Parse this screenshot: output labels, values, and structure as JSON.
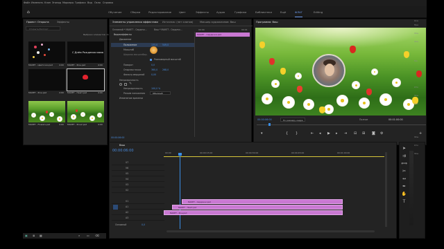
{
  "menu": {
    "items": [
      "Файл",
      "Изменить",
      "Клип",
      "Эпизод",
      "Маркеры",
      "Графика",
      "Вид",
      "Окно",
      "Справка"
    ]
  },
  "workspaces": {
    "items": [
      "Обучение",
      "Сборка",
      "Редактирование",
      "Цвет",
      "Эффекты",
      "Аудио",
      "Графика",
      "Библиотеки",
      "Ещё",
      "ФЛАГ",
      "Editing"
    ],
    "active": "ФЛАГ"
  },
  "project": {
    "tab_active": "Проект: Открыта",
    "tab_other": "Эффекты",
    "search_placeholder": "Открыть/Экспорт",
    "items_count": "Выбрано элементов: 0 из 12",
    "thumbs": [
      {
        "name": "МАКЕТ - Цветочки.psd",
        "dur": "4:00"
      },
      {
        "name": "МАКЕТ - Фон.psd",
        "dur": "4:00"
      },
      {
        "name": "МАКЕТ - Фон.psd",
        "dur": "4:00"
      },
      {
        "name": "МАКЕТ - Heart.psd",
        "dur": "4:00"
      },
      {
        "name": "МАКЕТ - Flowers.psd",
        "dur": "4:00"
      },
      {
        "name": "МАКЕТ - Фон2.psd",
        "dur": "4:00"
      }
    ],
    "thumb_caption": "С Днём Рождения мама"
  },
  "effect_controls": {
    "tabs": [
      "Элементы управления эффектами",
      "Источник: (нет клипов)",
      "Микшер аудиоклипов: Ваш"
    ],
    "source": "Основной * МАКЕТ - Сердечк...",
    "sequence": "Ваш * МАКЕТ - Сердечк...",
    "section_video": "Видеоэффекты",
    "fx_motion": "Движение",
    "position_label": "Положение",
    "position_x": "133,0",
    "position_y": "549,0",
    "scale_label": "Масштаб",
    "scale_value": "100,0",
    "scale_width_label": "Ширина масштабир.",
    "uniform_label": "Равномерный масштаб",
    "rotation_label": "Поворот",
    "rotation_value": "0,0",
    "anchor_label": "Опорная точка",
    "anchor_x": "360,0",
    "anchor_y": "268,0",
    "flicker_label": "Фильтр мерцаний",
    "flicker_value": "0,00",
    "opacity_section": "Непрозрачность",
    "opacity_label": "Непрозрачность",
    "opacity_value": "100,0 %",
    "blend_label": "Режим наложения",
    "blend_value": "Обычный",
    "time_remap": "Изменение времени",
    "ruler_start": "00:00",
    "ruler_end": "00:01",
    "clip_label": "МАКЕТ - Сердечки.psd",
    "timecode": "00:00:06:00"
  },
  "program": {
    "title": "Программа: Ваш",
    "timecode": "00:00:06:00",
    "fit": "По размеру кадра",
    "quality": "Полное",
    "duration": "00:01:00:00"
  },
  "timeline": {
    "tab": "Ваш",
    "timecode": "00:00:06:00",
    "ruler": [
      "00:00",
      "00:00:15:00",
      "00:00:30:00",
      "00:00:45:00",
      "00:01:00:00"
    ],
    "video_tracks": [
      "V7",
      "V6",
      "V5",
      "V4",
      "V3",
      "V2",
      "V1"
    ],
    "audio_tracks": [
      "A1",
      "A2",
      "A3"
    ],
    "master_label": "Основной",
    "master_value": "0,0",
    "clips": [
      {
        "name": "МАКЕТ - Сердечки.psd"
      },
      {
        "name": "МАКЕТ - Heart.psd"
      },
      {
        "name": "МАКЕТ - Фон.psd"
      }
    ]
  },
  "right_labels": [
    "Ося",
    "Пра",
    "Фон",
    "Фон",
    "Ми",
    "Ото",
    "Фон",
    "Вио",
    "Фон",
    "Ото",
    "Фон"
  ],
  "colors": {
    "accent": "#4a8de0",
    "clip": "#c978d2",
    "playhead": "#3a8ee6"
  }
}
